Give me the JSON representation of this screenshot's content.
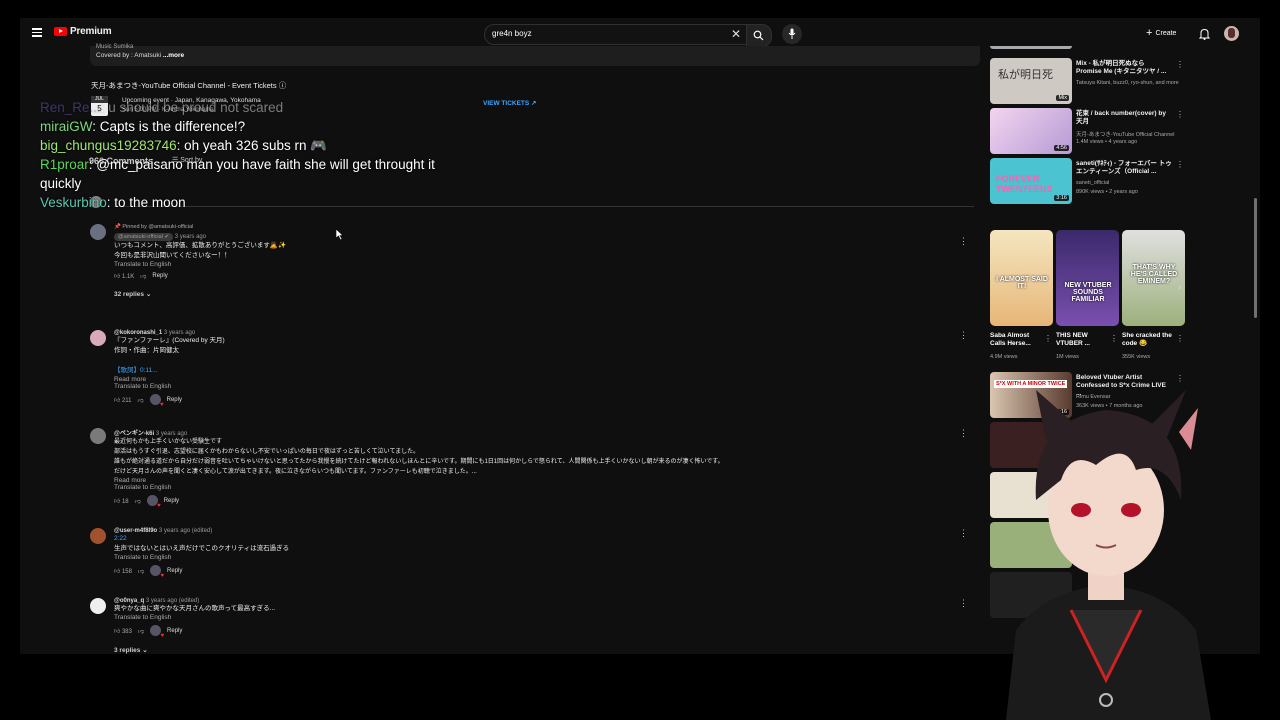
{
  "header": {
    "logo_text": "Premium",
    "search_value": "gre4n boyz",
    "create_label": "Create"
  },
  "description": {
    "line1": "Music Sumika",
    "covered_by": "Covered by : Amatsuki",
    "more": "...more"
  },
  "event": {
    "section_title": "天月-あまつき-YouTube Official Channel - Event Tickets",
    "month": "JUL",
    "day": "5",
    "line1": "Upcoming event · Japan, Kanagawa, Yokohama",
    "line2": "Sun 5:00 PM · K-Arena Yokohama",
    "view_tickets": "VIEW TICKETS"
  },
  "comments_header": {
    "count": "966 Comments",
    "sort_label": "Sort by"
  },
  "comments": [
    {
      "pinned": "Pinned by @amatsuki-official",
      "user": "@amatsuki-official",
      "time": "3 years ago",
      "lines": [
        "いつもコメント、高評価、拡散ありがとうございます🙇✨",
        "今回も是非沢山聞いてくださいなー！！"
      ],
      "translate": "Translate to English",
      "likes": "1.1K",
      "reply": "Reply",
      "replies": "32 replies"
    },
    {
      "user": "@kokoronashi_1",
      "time": "3 years ago",
      "lines": [
        "『ファンファーレ』(Covered by 天月)",
        "作詞・作曲：片岡健太",
        "",
        "【歌詞】0:11..."
      ],
      "read_more": "Read more",
      "translate": "Translate to English",
      "likes": "211",
      "reply": "Reply"
    },
    {
      "user": "@ペンギン-k6i",
      "time": "3 years ago",
      "lines": [
        "最近何もかも上手くいかない受験生です",
        "部活はもうすぐ引退、志望校に届くかもわからないし不安でいっぱいの毎日で夜はずっと苦しくて泣いてました。",
        "誰もが絶対通る道だから自分だけ弱音を吐いてちゃいけないと思ってたから我慢を続けてたけど報われないしほんとに辛いです。期間にも1日1回は何かしらで怒られて、人間関係も上手くいかないし朝が来るのが凄く怖いです。",
        "だけど天月さんの声を聞くと凄く安心して涙が出てきます。夜に泣きながらいつも聞いてます。ファンファーレも初聴で泣きました。..."
      ],
      "read_more": "Read more",
      "translate": "Translate to English",
      "likes": "18",
      "reply": "Reply"
    },
    {
      "user": "@user-m4f8l9o",
      "time": "3 years ago (edited)",
      "link": "2:22",
      "lines": [
        "生声ではないとはいえ声だけでこのクオリティは流石過ぎる"
      ],
      "translate": "Translate to English",
      "likes": "158",
      "reply": "Reply"
    },
    {
      "user": "@o0nya_q",
      "time": "3 years ago (edited)",
      "lines": [
        "爽やかな曲に爽やかな天月さんの歌声って最高すぎる..."
      ],
      "translate": "Translate to English",
      "likes": "383",
      "reply": "Reply",
      "replies": "3 replies"
    }
  ],
  "sidebar": {
    "videos": [
      {
        "title": "Mix - 私が明日死ぬなら Promise Me (キタニタツヤ / ...",
        "channel": "Tatsuya Kitani, buzz0, ryo-shun, and more",
        "meta": "",
        "badge": "Mix",
        "color": "#cfc9c4"
      },
      {
        "title": "花束 / back number(cover) by 天月",
        "channel": "天月-あまつき-YouTube Official Channel",
        "meta": "1.4M views • 4 years ago",
        "badge": "4:56",
        "color": "#c7a7d8"
      },
      {
        "title": "saneti(ｻﾈﾃｨ) - フォーエバー トゥエンティーンズ（Official ...",
        "channel": "saneti_official",
        "meta": "890K views • 2 years ago",
        "badge": "3:16",
        "color": "#4cc3d1"
      }
    ],
    "shorts": [
      {
        "title": "Saba Almost Calls Herse...",
        "views": "4.9M views",
        "caption": "I ALMOST SAID IT!",
        "color": "#e9cf8a"
      },
      {
        "title": "THIS NEW VTUBER ...",
        "views": "1M views",
        "caption": "NEW VTUBER SOUNDS FAMILIAR",
        "color": "#5b3a8c"
      },
      {
        "title": "She cracked the code 😂",
        "views": "355K views",
        "caption": "THAT'S WHY HE'S CALLED EMINEM?",
        "color": "#b9c49c"
      }
    ],
    "videos2": [
      {
        "title": "Beloved Vtuber Artist Confessed to S*x Crime LIVE ...",
        "channel": "Rimu Evensar",
        "meta": "363K views • 7 months ago",
        "badge": "31:16",
        "color": "#5a3a30"
      }
    ]
  },
  "chat": [
    {
      "name": "Ren_Re...",
      "text": ": u should be proud not scared",
      "color": "#7f5fd6",
      "faded": true
    },
    {
      "name": "miraiGW",
      "text": ": Capts is the difference!?",
      "color": "#7ed87e",
      "faded": false
    },
    {
      "name": "big_chungus19283746",
      "text": ": oh yeah 326 subs rn 🎮",
      "color": "#9ee86e",
      "faded": false
    },
    {
      "name": "R1proar",
      "text": ": @mc_paisano man you have faith she will get throught it quickly",
      "color": "#5bd65b",
      "faded": false
    },
    {
      "name": "Veskurbino",
      "text": ": to the moon",
      "color": "#5bc7b0",
      "faded": false
    }
  ]
}
